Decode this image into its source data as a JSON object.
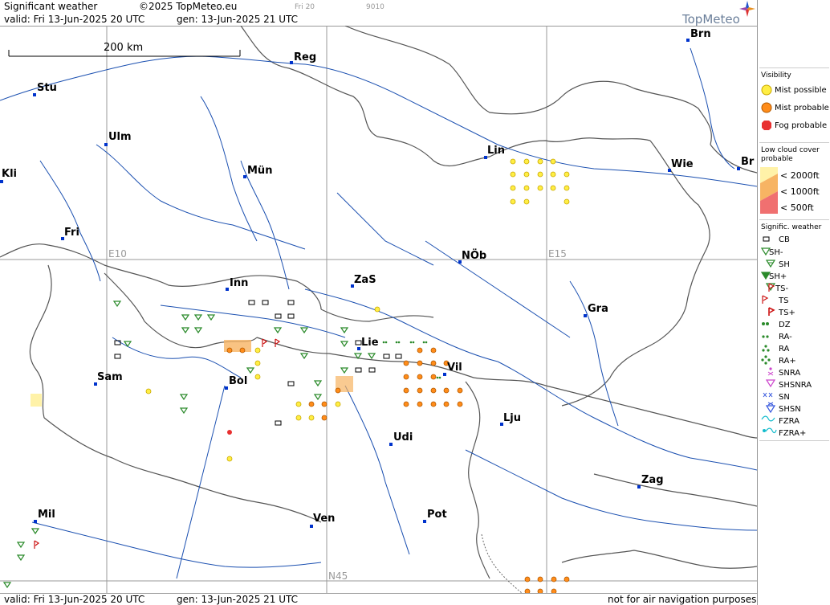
{
  "header": {
    "title": "Significant weather",
    "copyright": "©2025 TopMeteo.eu",
    "small1": "Fri 20",
    "small2": "9010",
    "valid": "valid:  Fri  13-Jun-2025  20 UTC",
    "generated": "gen: 13-Jun-2025  21  UTC",
    "brand": "TopMeteo"
  },
  "footer": {
    "valid": "valid:  Fri  13-Jun-2025  20 UTC",
    "generated": "gen: 13-Jun-2025  21  UTC",
    "disclaimer": "not for air navigation purposes"
  },
  "scale_label": "200 km",
  "grid_labels": {
    "e10": "E10",
    "e15": "E15",
    "n45": "N45"
  },
  "cities": {
    "brn": "Brn",
    "reg": "Reg",
    "stu": "Stu",
    "ulm": "Ulm",
    "lin": "Lin",
    "wie": "Wie",
    "bra": "Br",
    "kli": "Kli",
    "mun": "Mün",
    "fri": "Fri",
    "nob": "NÖb",
    "inn": "Inn",
    "zas": "ZaS",
    "gra": "Gra",
    "lie": "Lie",
    "vil": "Vil",
    "sam": "Sam",
    "bol": "Bol",
    "lju": "Lju",
    "udi": "Udi",
    "zag": "Zag",
    "mil": "Mil",
    "ven": "Ven",
    "pot": "Pot"
  },
  "legend": {
    "visibility_title": "Visibility",
    "mist_possible": "Mist possible",
    "mist_probable": "Mist probable",
    "fog_probable": "Fog probable",
    "cloud_title_1": "Low cloud cover",
    "cloud_title_2": "probable",
    "c2000": "< 2000ft",
    "c1000": "< 1000ft",
    "c500": "<   500ft",
    "sig_title": "Signific. weather",
    "cb": "CB",
    "sh_minus": "SH-",
    "sh": "SH",
    "sh_plus": "SH+",
    "ts_minus": "TS-",
    "ts": "TS",
    "ts_plus": "TS+",
    "dz": "DZ",
    "ra_minus": "RA-",
    "ra": "RA",
    "ra_plus": "RA+",
    "snra": "SNRA",
    "shsnra": "SHSNRA",
    "sn": "SN",
    "shsn": "SHSN",
    "fzra": "FZRA",
    "fzra_plus": "FZRA+"
  },
  "colors": {
    "river": "#1a4fb0",
    "border": "#555555",
    "grid": "#999999",
    "mist_possible": "#ffee44",
    "mist_probable": "#ff8c1a",
    "fog_probable": "#e83030",
    "cloud_2000": "#fff2a8",
    "cloud_1000": "#f7b463",
    "cloud_500": "#f07070",
    "shower": "#2a8a2a",
    "thunder": "#cc1111",
    "snow": "#3355dd",
    "mixed": "#cc44cc",
    "freezing": "#11bbcc"
  }
}
